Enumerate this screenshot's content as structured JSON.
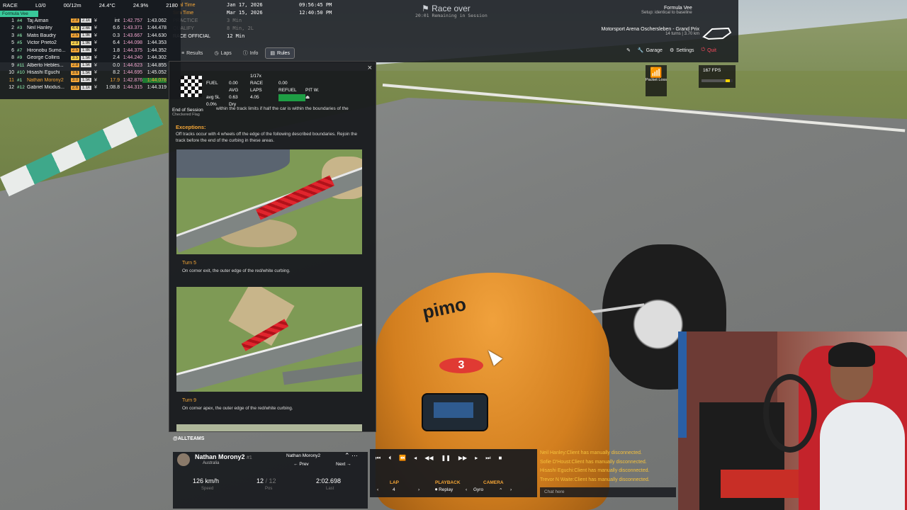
{
  "standings": {
    "session": "RACE",
    "lap": "L0/0",
    "time": "00/12m",
    "air_temp": "24.4°C",
    "humidity": "24.9%",
    "sof": "2180",
    "class": "Formula Vee",
    "rows": [
      {
        "pos": "1",
        "num": "#4",
        "name": "Taj Aiman",
        "lic": "2.8",
        "ir": "2.1k",
        "gap": "int",
        "last": "1:42.757",
        "best": "1:43.062",
        "me": false
      },
      {
        "pos": "2",
        "num": "#3",
        "name": "Neil Hanley",
        "lic": "4.4",
        "ir": "2.6k",
        "gap": "6.6",
        "last": "1:43.371",
        "best": "1:44.478",
        "me": false
      },
      {
        "pos": "3",
        "num": "#6",
        "name": "Matis Baudry",
        "lic": "2.5",
        "ir": "1.9k",
        "gap": "0.3",
        "last": "1:43.667",
        "best": "1:44.630",
        "me": false
      },
      {
        "pos": "5",
        "num": "#5",
        "name": "Victor Prieto2",
        "lic": "2.9",
        "ir": "1.9k",
        "gap": "6.4",
        "last": "1:44.098",
        "best": "1:44.353",
        "me": false
      },
      {
        "pos": "6",
        "num": "#7",
        "name": "Hironobu Sumo...",
        "lic": "2.5",
        "ir": "1.8k",
        "gap": "1.8",
        "last": "1:44.375",
        "best": "1:44.352",
        "me": false
      },
      {
        "pos": "8",
        "num": "#9",
        "name": "George Collins",
        "lic": "3.5",
        "ir": "1.5k",
        "gap": "2.4",
        "last": "1:44.240",
        "best": "1:44.302",
        "me": false
      },
      {
        "pos": "9",
        "num": "#11",
        "name": "Alberto Hebles...",
        "lic": "2.8",
        "ir": "1.5k",
        "gap": "0.0",
        "last": "1:44.623",
        "best": "1:44.855",
        "me": false
      },
      {
        "pos": "10",
        "num": "#10",
        "name": "Hisashi Eguchi",
        "lic": "3.6",
        "ir": "1.5k",
        "gap": "8.2",
        "last": "1:44.695",
        "best": "1:45.052",
        "me": false
      },
      {
        "pos": "11",
        "num": "#1",
        "name": "Nathan Morony2",
        "lic": "3.0",
        "ir": "1.5k",
        "gap": "17.9",
        "last": "1:42.876",
        "best": "1:44.078",
        "me": true
      },
      {
        "pos": "12",
        "num": "#12",
        "name": "Gabriel Miodus...",
        "lic": "2.6",
        "ir": "1.1k",
        "gap": "1:08.8",
        "last": "1:44.315",
        "best": "1:44.319",
        "me": false
      }
    ]
  },
  "session": {
    "real_time_label": "Real Time",
    "sim_time_label": "Sim Time",
    "practice": "PRACTICE",
    "qualify": "QUALIFY",
    "race_official": "RACE OFFICIAL",
    "real_date": "Jan 17, 2026",
    "sim_date": "Mar 15, 2026",
    "real_clock": "09:56:45 PM",
    "sim_clock": "12:40:50 PM",
    "practice_val": "3 Min",
    "qualify_val": "8 Min, 2L",
    "race_val": "12 Min"
  },
  "status": {
    "race_over": "Race over",
    "remaining": "20:01 Remaining in Session"
  },
  "car": {
    "name": "Formula Vee",
    "setup": "Setup: identical to baseline"
  },
  "track": {
    "name": "Motorsport Arena Oschersleben - Grand Prix",
    "sub": "14 turns | 3.70 km"
  },
  "nav": {
    "results": "Results",
    "laps": "Laps",
    "info": "Info",
    "rules": "Rules",
    "garage": "Garage",
    "settings": "Settings",
    "quit": "Quit"
  },
  "overlays": {
    "packet_loss": "Packet Loss",
    "fps": "167 FPS"
  },
  "panel": {
    "close": "×",
    "eos_title": "End of Session",
    "eos_sub": "Checkered Flag",
    "lap_of": "1/17x",
    "fuel_label": "FUEL",
    "race_label": "RACE",
    "refuel_label": "REFUEL",
    "pitw_label": "PIT W.",
    "avg_label": "AVG",
    "laps_label": "LAPS",
    "fuel_val": "0.00",
    "race_fuel_val": "0.00",
    "avg_val": "0.63",
    "laps_val": "4.05",
    "avg_unit": "avg 5L",
    "fuel_pct": "0.0%",
    "weather": "Dry",
    "rule_text": "within the track limits if half the car is within the boundaries of the",
    "exceptions_title": "Exceptions:",
    "exceptions_text": "Off tracks occur with 4 wheels off the edge of the following described boundaries. Rejoin the track before the end of the curbing in these areas.",
    "turn5_title": "Turn 5",
    "turn5_text": "On corner exit, the outer edge of the red/white curbing.",
    "turn9_title": "Turn 9",
    "turn9_text": "On corner apex, the outer edge of the red/white curbing."
  },
  "driver": {
    "team_filter": "@ALLTEAMS",
    "name": "Nathan Morony2",
    "pos": "#1",
    "country": "Australia",
    "selector": "Nathan Morony2",
    "prev": "Prev",
    "next": "Next",
    "speed": "126 km/h",
    "speed_label": "Speed",
    "position": "12",
    "position_of": "/ 12",
    "position_label": "Pos",
    "last": "2:02.698",
    "last_label": "Last"
  },
  "replay": {
    "lap_label": "LAP",
    "lap_val": "4",
    "playback_label": "PLAYBACK",
    "playback_val": "Replay",
    "camera_label": "CAMERA",
    "camera_val": "Gyro"
  },
  "chat": {
    "messages": [
      "Neil Hanley:Client has manually disconnected.",
      "Sofie D'Houst:Client has manually disconnected.",
      "Hisashi Eguchi:Client has manually disconnected.",
      "Trevor N Waite:Client has manually disconnected."
    ],
    "placeholder": "Chat here"
  },
  "car_body": {
    "number": "3",
    "logo": "pimo"
  },
  "colors": {
    "accent": "#f5a636",
    "class_green": "#39c89a",
    "quit_red": "#ff4c5e",
    "chat_yellow": "#f5c13c"
  }
}
